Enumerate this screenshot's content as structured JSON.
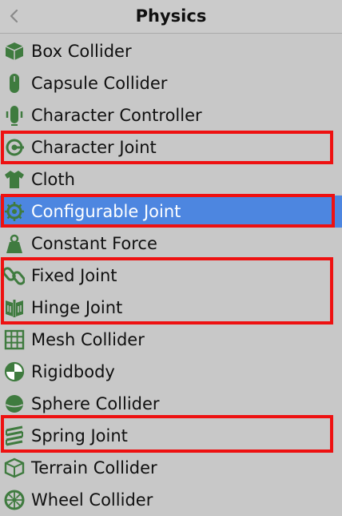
{
  "header": {
    "title": "Physics",
    "back_icon": "chevron-left-icon"
  },
  "colors": {
    "icon_green": "#3f7b3f",
    "selection": "#4d86e0",
    "highlight": "#ee1111"
  },
  "items": [
    {
      "label": "Box Collider",
      "icon": "box-collider-icon"
    },
    {
      "label": "Capsule Collider",
      "icon": "capsule-collider-icon"
    },
    {
      "label": "Character Controller",
      "icon": "character-controller-icon"
    },
    {
      "label": "Character Joint",
      "icon": "character-joint-icon"
    },
    {
      "label": "Cloth",
      "icon": "cloth-icon"
    },
    {
      "label": "Configurable Joint",
      "icon": "configurable-joint-icon",
      "selected": true
    },
    {
      "label": "Constant Force",
      "icon": "constant-force-icon"
    },
    {
      "label": "Fixed Joint",
      "icon": "fixed-joint-icon"
    },
    {
      "label": "Hinge Joint",
      "icon": "hinge-joint-icon"
    },
    {
      "label": "Mesh Collider",
      "icon": "mesh-collider-icon"
    },
    {
      "label": "Rigidbody",
      "icon": "rigidbody-icon"
    },
    {
      "label": "Sphere Collider",
      "icon": "sphere-collider-icon"
    },
    {
      "label": "Spring Joint",
      "icon": "spring-joint-icon"
    },
    {
      "label": "Terrain Collider",
      "icon": "terrain-collider-icon"
    },
    {
      "label": "Wheel Collider",
      "icon": "wheel-collider-icon"
    }
  ]
}
